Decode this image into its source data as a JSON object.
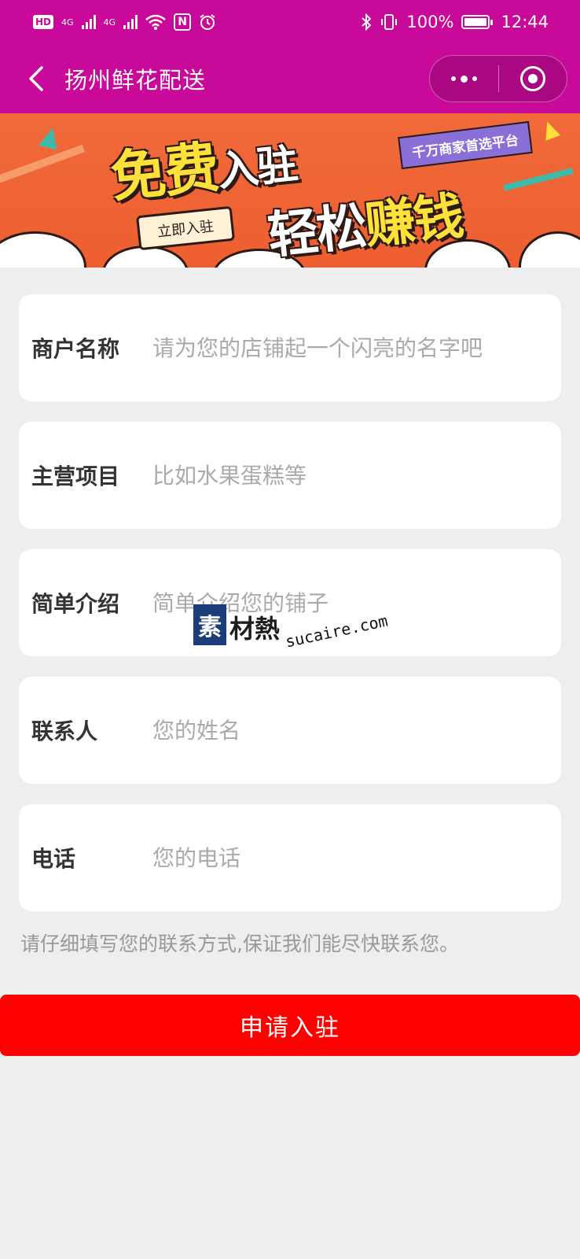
{
  "status_bar": {
    "hd_badge": "HD",
    "network_1": "4G",
    "network_2": "4G",
    "nfc": "N",
    "battery_percent": "100%",
    "time": "12:44"
  },
  "nav": {
    "title": "扬州鲜花配送"
  },
  "banner": {
    "title_line1_big": "免费",
    "title_line1_small": "入驻",
    "title_line2_plain": "轻松",
    "title_line2_highlight": "赚钱",
    "tag": "千万商家首选平台",
    "cta": "立即入驻"
  },
  "form": {
    "fields": [
      {
        "label": "商户名称",
        "placeholder": "请为您的店铺起一个闪亮的名字吧",
        "value": ""
      },
      {
        "label": "主营项目",
        "placeholder": "比如水果蛋糕等",
        "value": ""
      },
      {
        "label": "简单介绍",
        "placeholder": "简单介绍您的铺子",
        "value": ""
      },
      {
        "label": "联系人",
        "placeholder": "您的姓名",
        "value": ""
      },
      {
        "label": "电话",
        "placeholder": "您的电话",
        "value": ""
      }
    ],
    "hint": "请仔细填写您的联系方式,保证我们能尽快联系您。",
    "submit_label": "申请入驻"
  },
  "watermark": {
    "logo_char": "素",
    "text": "材熱",
    "url": "sucaire.com"
  },
  "colors": {
    "brand_magenta": "#c8099a",
    "submit_red": "#ff0000",
    "background": "#eeeeee"
  }
}
